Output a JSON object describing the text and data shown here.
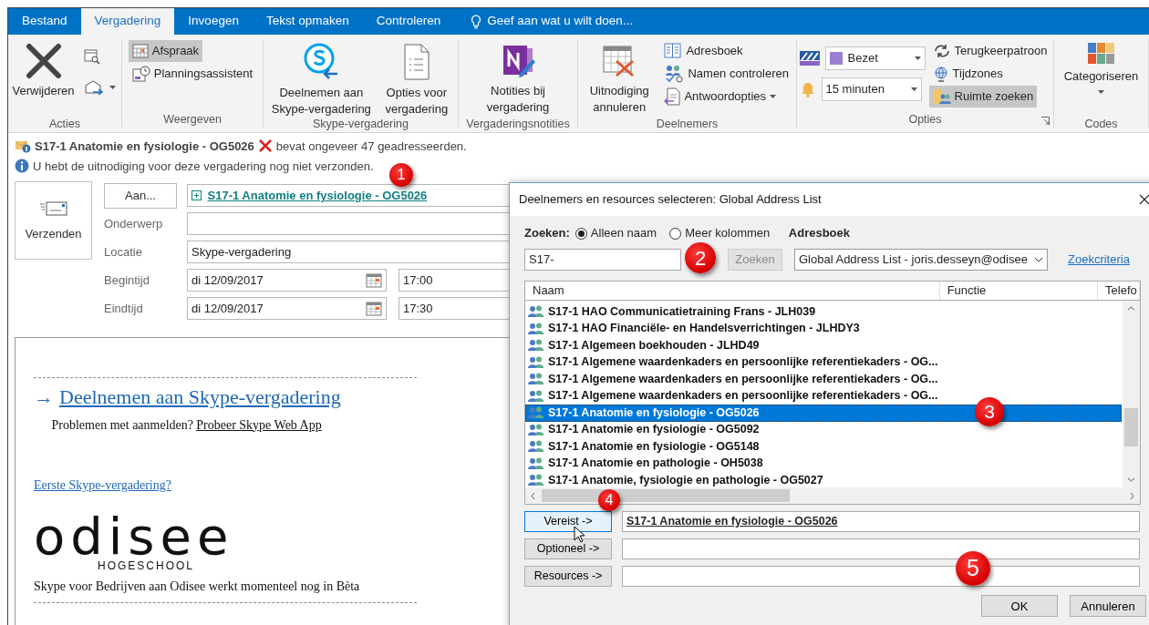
{
  "tabs": [
    {
      "label": "Bestand",
      "selected": false
    },
    {
      "label": "Vergadering",
      "selected": true
    },
    {
      "label": "Invoegen",
      "selected": false
    },
    {
      "label": "Tekst opmaken",
      "selected": false
    },
    {
      "label": "Controleren",
      "selected": false
    }
  ],
  "tell_me": "Geef aan wat u wilt doen...",
  "ribbon": [
    {
      "label": "Acties",
      "items": [
        {
          "kind": "large",
          "label": "Verwijderen"
        },
        {
          "kind": "icon"
        },
        {
          "kind": "icon_menu"
        }
      ]
    },
    {
      "label": "Weergeven",
      "items": [
        {
          "kind": "small",
          "label": "Afspraak",
          "selected": true
        },
        {
          "kind": "small",
          "label": "Planningsassistent",
          "selected": false
        }
      ]
    },
    {
      "label": "Skype-vergadering",
      "items": [
        {
          "kind": "large",
          "label": "Deelnemen aan Skype-vergadering"
        },
        {
          "kind": "large",
          "label": "Opties voor vergadering"
        }
      ]
    },
    {
      "label": "Vergaderingsnotities",
      "items": [
        {
          "kind": "large",
          "label": "Notities bij vergadering"
        }
      ]
    },
    {
      "label": "Deelnemers",
      "items": [
        {
          "kind": "large",
          "label": "Uitnodiging annuleren"
        },
        {
          "kind": "small",
          "label": "Adresboek"
        },
        {
          "kind": "small",
          "label": "Namen controleren"
        },
        {
          "kind": "small_menu",
          "label": "Antwoordopties"
        }
      ]
    },
    {
      "label": "Opties",
      "launcher": true,
      "items": [
        {
          "kind": "select",
          "value": "Bezet",
          "color": "#9b7fd4"
        },
        {
          "kind": "select",
          "value": "15 minuten"
        },
        {
          "kind": "small",
          "label": "Terugkeerpatroon",
          "selected": false
        },
        {
          "kind": "small",
          "label": "Tijdzones",
          "selected": false
        },
        {
          "kind": "small",
          "label": "Ruimte zoeken",
          "selected": true
        }
      ]
    },
    {
      "label": "Codes",
      "items": [
        {
          "kind": "large_menu",
          "label": "Categoriseren"
        }
      ]
    }
  ],
  "info": {
    "recipient": "S17-1 Anatomie en fysiologie - OG5026",
    "warning": "bevat ongeveer 47 geadresseerden.",
    "notice": "U hebt de uitnodiging voor deze vergadering nog niet verzonden."
  },
  "send_button": "Verzenden",
  "form": {
    "to_button": "Aan...",
    "to_value": "S17-1 Anatomie en fysiologie - OG5026",
    "fields": [
      {
        "label": "Onderwerp"
      },
      {
        "label": "Locatie",
        "value": "Skype-vergadering"
      }
    ],
    "times": [
      {
        "label": "Begintijd",
        "date": "di 12/09/2017",
        "time": "17:00"
      },
      {
        "label": "Eindtijd",
        "date": "di 12/09/2017",
        "time": "17:30"
      }
    ]
  },
  "body": {
    "join_arrow": "→",
    "join_link": "Deelnemen aan Skype-vergadering",
    "problem_text": "Problemen met aanmelden?",
    "problem_link": "Probeer Skype Web App",
    "first_link": "Eerste Skype-vergadering?",
    "logo_name": "odisee",
    "logo_subtitle": "HOGESCHOOL",
    "footer": "Skype voor Bedrijven aan Odisee werkt momenteel nog in Bèta"
  },
  "dialog": {
    "title": "Deelnemers en resources selecteren: Global Address List",
    "search_label": "Zoeken:",
    "radios": [
      {
        "label": "Alleen naam",
        "selected": true
      },
      {
        "label": "Meer kolommen",
        "selected": false
      }
    ],
    "search_value": "S17-",
    "search_button": {
      "label": "Zoeken",
      "disabled": true
    },
    "addressbook_label": "Adresboek",
    "addressbook_value": "Global Address List - joris.desseyn@odisee",
    "criteria_link": "Zoekcriteria",
    "columns": [
      "Naam",
      "Functie",
      "Telefo"
    ],
    "rows": [
      {
        "name": "S17-1  HAO Communicatietraining Frans - JLH039",
        "selected": false
      },
      {
        "name": "S17-1  HAO Financiële- en  Handelsverrichtingen - JLHDY3",
        "selected": false
      },
      {
        "name": "S17-1 Algemeen boekhouden - JLHD49",
        "selected": false
      },
      {
        "name": "S17-1 Algemene waardenkaders en persoonlijke referentiekaders - OG...",
        "selected": false
      },
      {
        "name": "S17-1 Algemene waardenkaders en persoonlijke referentiekaders - OG...",
        "selected": false
      },
      {
        "name": "S17-1 Algemene waardenkaders en persoonlijke referentiekaders - OG...",
        "selected": false
      },
      {
        "name": "S17-1 Anatomie en fysiologie - OG5026",
        "selected": true
      },
      {
        "name": "S17-1 Anatomie en fysiologie - OG5092",
        "selected": false
      },
      {
        "name": "S17-1 Anatomie en fysiologie - OG5148",
        "selected": false
      },
      {
        "name": "S17-1 Anatomie en pathologie - OH5038",
        "selected": false
      },
      {
        "name": "S17-1 Anatomie, fysiologie en pathologie - OG5027",
        "selected": false
      }
    ],
    "recipients": [
      {
        "button": "Vereist ->",
        "value": "S17-1 Anatomie en fysiologie - OG5026"
      },
      {
        "button": "Optioneel ->"
      },
      {
        "button": "Resources ->"
      }
    ],
    "ok": "OK",
    "cancel": "Annuleren"
  },
  "callouts": [
    {
      "label": "1"
    },
    {
      "label": "2"
    },
    {
      "label": "3"
    },
    {
      "label": "4"
    },
    {
      "label": "5"
    }
  ]
}
